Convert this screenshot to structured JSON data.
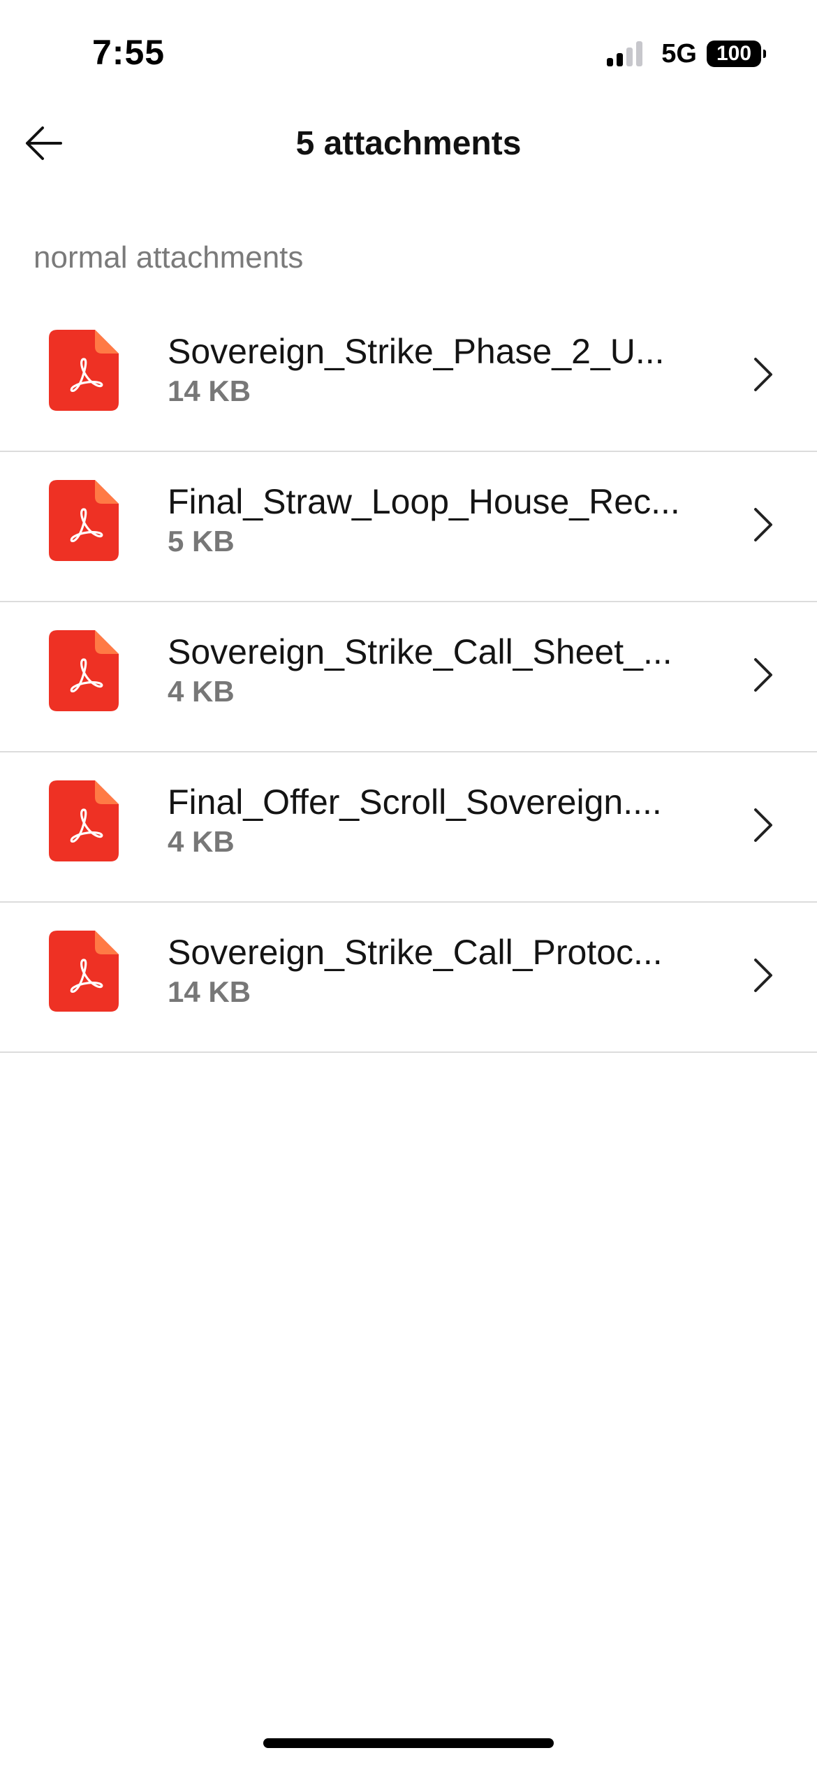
{
  "status_bar": {
    "time": "7:55",
    "network": "5G",
    "battery": "100",
    "signal_bars_active": 2
  },
  "header": {
    "title": "5 attachments",
    "back_icon": "arrow-left-icon"
  },
  "section": {
    "label": "normal attachments"
  },
  "attachments": [
    {
      "name": "Sovereign_Strike_Phase_2_U...",
      "size": "14 KB",
      "icon": "pdf-file-icon"
    },
    {
      "name": "Final_Straw_Loop_House_Rec...",
      "size": "5 KB",
      "icon": "pdf-file-icon"
    },
    {
      "name": "Sovereign_Strike_Call_Sheet_...",
      "size": "4 KB",
      "icon": "pdf-file-icon"
    },
    {
      "name": "Final_Offer_Scroll_Sovereign....",
      "size": "4 KB",
      "icon": "pdf-file-icon"
    },
    {
      "name": "Sovereign_Strike_Call_Protoc...",
      "size": "14 KB",
      "icon": "pdf-file-icon"
    }
  ],
  "colors": {
    "pdf_icon": "#ee3124",
    "pdf_icon_fold": "#ff7a45",
    "secondary_text": "#777777",
    "divider": "#dcdcdc"
  }
}
